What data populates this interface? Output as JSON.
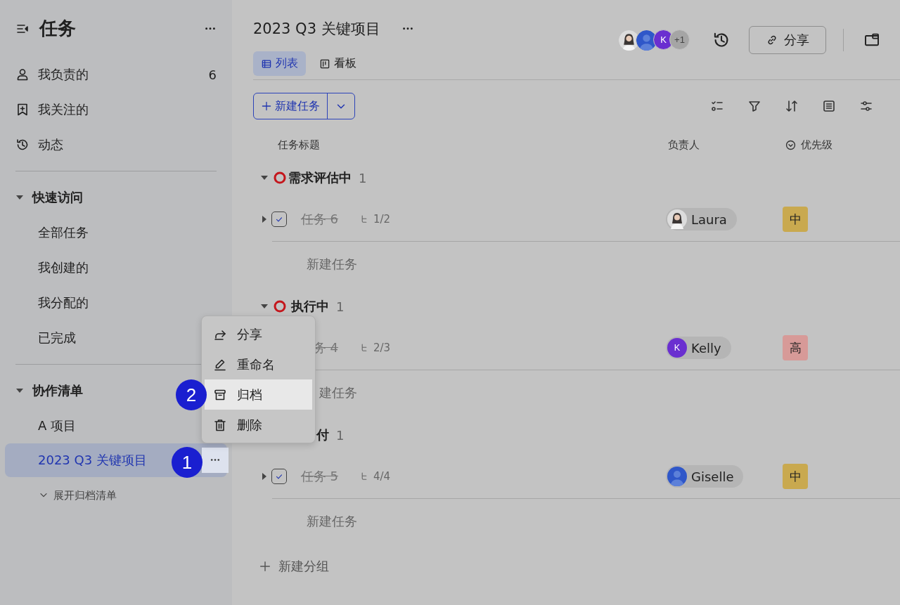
{
  "sidebar": {
    "title": "任务",
    "nav": [
      {
        "label": "我负责的",
        "count": "6"
      },
      {
        "label": "我关注的"
      },
      {
        "label": "动态"
      }
    ],
    "sections": [
      {
        "title": "快速访问",
        "expanded": true,
        "items": [
          {
            "label": "全部任务",
            "selected": false
          },
          {
            "label": "我创建的",
            "selected": false
          },
          {
            "label": "我分配的",
            "selected": false
          },
          {
            "label": "已完成",
            "selected": false
          }
        ]
      },
      {
        "title": "协作清单",
        "expanded": true,
        "items": [
          {
            "label": "A 项目",
            "selected": false
          },
          {
            "label": "2023 Q3 关键项目",
            "selected": true
          }
        ]
      }
    ],
    "archive_toggle": "展开归档清单"
  },
  "project": {
    "title": "2023 Q3 关键项目",
    "tabs": [
      {
        "label": "列表",
        "selected": true
      },
      {
        "label": "看板",
        "selected": false
      }
    ],
    "members": [
      {
        "kind": "photo"
      },
      {
        "kind": "silhouette"
      },
      {
        "kind": "initial",
        "text": "K"
      },
      {
        "kind": "more",
        "text": "+1"
      }
    ],
    "share_button": "分享"
  },
  "toolbar": {
    "new_task": "新建任务"
  },
  "columns": [
    "任务标题",
    "负责人",
    "优先级"
  ],
  "groups": [
    {
      "name": "需求评估中",
      "count": "1",
      "expanded": true,
      "tasks": [
        {
          "title": "任务 6",
          "done": true,
          "checked": true,
          "expanded": false,
          "subtasks": "1/2",
          "assignee": {
            "name": "Laura",
            "avatar": {
              "kind": "photo"
            }
          },
          "priority": {
            "label": "中",
            "color": "#c9a94f"
          }
        }
      ],
      "new_task": "新建任务"
    },
    {
      "name": "执行中",
      "count": "1",
      "expanded": true,
      "tasks": [
        {
          "title": "务 4",
          "done": true,
          "subtasks": "2/3",
          "assignee": {
            "name": "Kelly",
            "avatar": {
              "kind": "initial",
              "text": "K"
            }
          },
          "priority": {
            "label": "高",
            "color": "#d79a98"
          }
        }
      ],
      "new_task": "建任务"
    },
    {
      "name": "付",
      "count": "1",
      "tasks": [
        {
          "title": "任务 5",
          "done": true,
          "checked": true,
          "expanded": false,
          "subtasks": "4/4",
          "assignee": {
            "name": "Giselle",
            "avatar": {
              "kind": "silhouette"
            }
          },
          "priority": {
            "label": "中",
            "color": "#c9a94f"
          }
        }
      ],
      "new_task": "新建任务"
    }
  ],
  "new_group": "新建分组",
  "context_menu": {
    "items": [
      {
        "label": "分享",
        "selected": false
      },
      {
        "label": "重命名",
        "selected": false
      },
      {
        "label": "归档",
        "selected": true
      },
      {
        "label": "删除",
        "selected": false
      }
    ]
  },
  "callouts": [
    {
      "number": "1"
    },
    {
      "number": "2"
    }
  ]
}
